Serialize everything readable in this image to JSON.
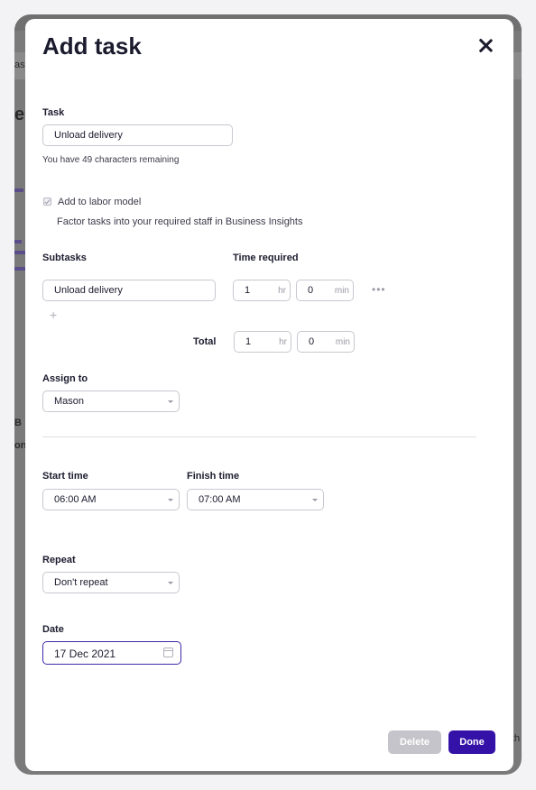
{
  "background": {
    "fragments": [
      "ask",
      "e",
      "B",
      "on",
      "th"
    ]
  },
  "modal": {
    "title": "Add task",
    "close_icon": "close-icon"
  },
  "task": {
    "label": "Task",
    "value": "Unload delivery",
    "helper": "You have 49 characters remaining"
  },
  "labor_model": {
    "checkbox_label": "Add to labor model",
    "checked": true,
    "description": "Factor tasks into your required staff in Business Insights"
  },
  "subtasks": {
    "label": "Subtasks",
    "time_label": "Time required",
    "items": [
      {
        "name": "Unload delivery",
        "hours": "1",
        "minutes": "0"
      }
    ],
    "hr_unit": "hr",
    "min_unit": "min",
    "more_icon": "more-horizontal-icon",
    "add_icon": "plus-icon",
    "total_label": "Total",
    "total_hours": "1",
    "total_minutes": "0"
  },
  "assign": {
    "label": "Assign to",
    "value": "Mason"
  },
  "schedule": {
    "start_label": "Start time",
    "start_value": "06:00 AM",
    "finish_label": "Finish time",
    "finish_value": "07:00 AM"
  },
  "repeat": {
    "label": "Repeat",
    "value": "Don't repeat"
  },
  "date": {
    "label": "Date",
    "value": "17 Dec 2021",
    "icon": "calendar-icon"
  },
  "actions": {
    "delete_label": "Delete",
    "done_label": "Done"
  },
  "colors": {
    "primary": "#3412a8",
    "disabled": "#c4c4ca"
  }
}
